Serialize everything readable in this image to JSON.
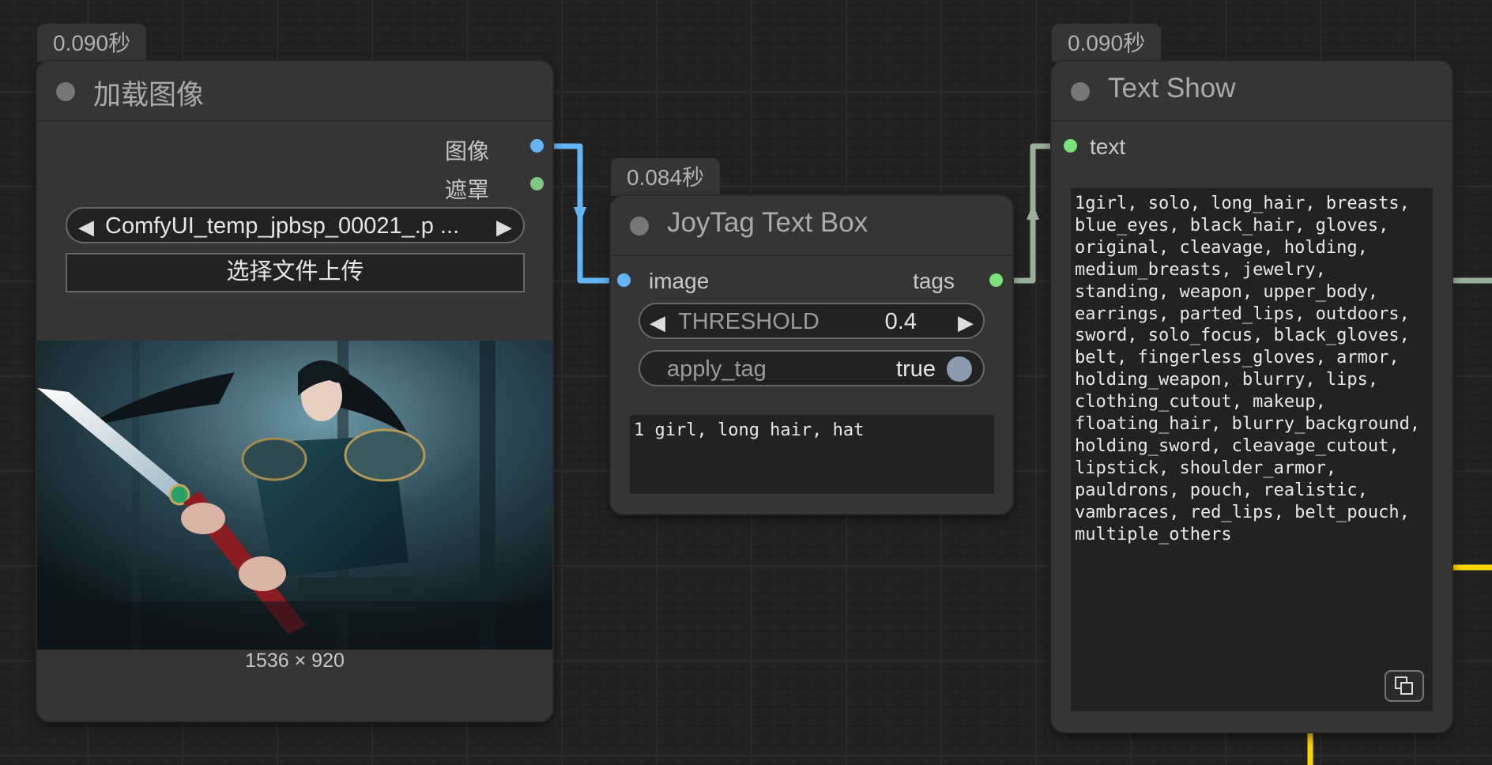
{
  "canvas": {
    "link_colors": {
      "image": "#64b5f6",
      "string": "#9ab09a",
      "other": "#ffd500"
    }
  },
  "load_image_node": {
    "time_badge": "0.090秒",
    "title": "加载图像",
    "outputs": [
      {
        "label": "图像",
        "color": "#64b5f6"
      },
      {
        "label": "遮罩",
        "color": "#81c784"
      }
    ],
    "file_combo": {
      "value": "ComfyUI_temp_jpbsp_00021_.p ...",
      "left_arrow": "◀",
      "right_arrow": "▶"
    },
    "upload_button": "选择文件上传",
    "image_size": "1536 × 920"
  },
  "joytag_node": {
    "time_badge": "0.084秒",
    "title": "JoyTag Text Box",
    "input": {
      "label": "image",
      "color": "#64b5f6"
    },
    "output": {
      "label": "tags",
      "color": "#7be37b"
    },
    "threshold": {
      "label": "THRESHOLD",
      "value": "0.4",
      "left_arrow": "◀",
      "right_arrow": "▶"
    },
    "apply_tag": {
      "label": "apply_tag",
      "value": "true"
    },
    "text": "1 girl, long hair, hat"
  },
  "text_show_node": {
    "time_badge": "0.090秒",
    "title": "Text Show",
    "input": {
      "label": "text",
      "color": "#7be37b"
    },
    "text": "1girl, solo, long_hair, breasts, blue_eyes, black_hair, gloves, original, cleavage, holding, medium_breasts, jewelry, standing, weapon, upper_body, earrings, parted_lips, outdoors, sword, solo_focus, black_gloves, belt, fingerless_gloves, armor, holding_weapon, blurry, lips, clothing_cutout, makeup, floating_hair, blurry_background, holding_sword, cleavage_cutout, lipstick, shoulder_armor, pauldrons, pouch, realistic, vambraces, red_lips, belt_pouch, multiple_others",
    "copy_icon": "copy-icon"
  }
}
